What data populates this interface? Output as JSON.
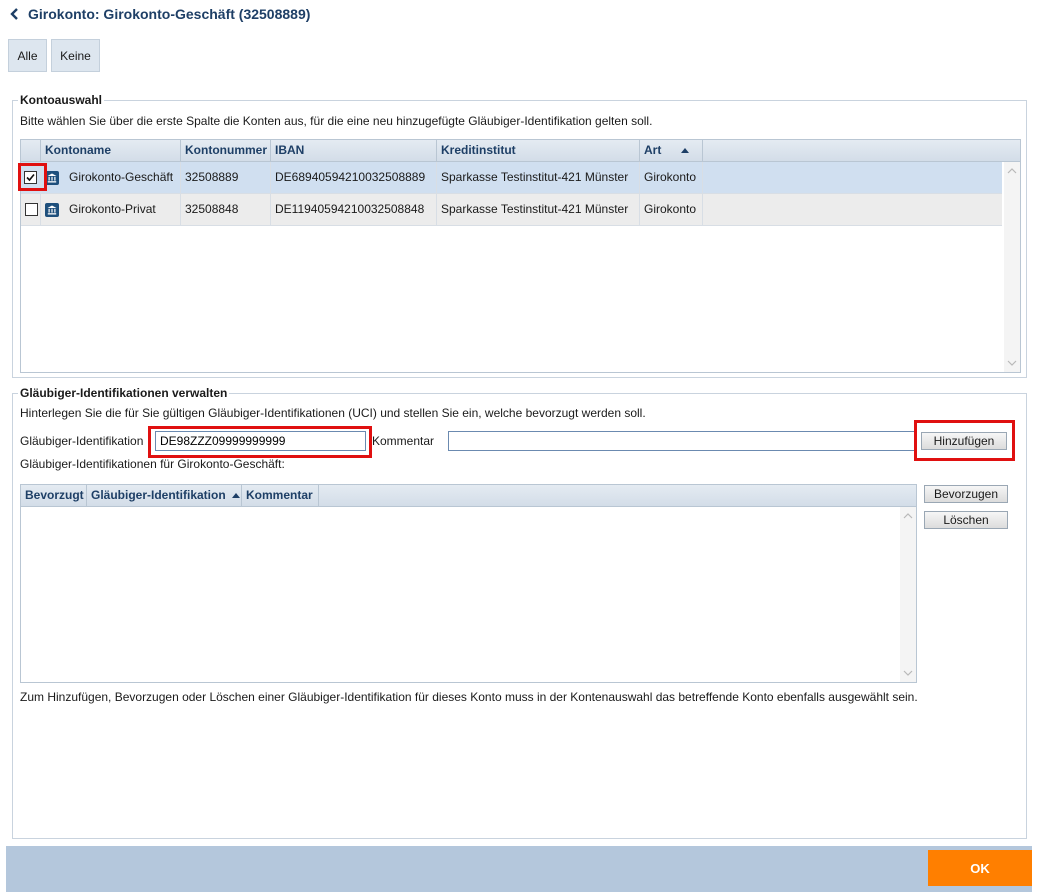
{
  "header": {
    "title": "Girokonto: Girokonto-Geschäft (32508889)"
  },
  "selection": {
    "all_label": "Alle",
    "none_label": "Keine"
  },
  "kontoauswahl": {
    "legend": "Kontoauswahl",
    "description": "Bitte wählen Sie über die erste Spalte die Konten aus, für die eine neu hinzugefügte Gläubiger-Identifikation gelten soll.",
    "columns": [
      "Kontoname",
      "Kontonummer",
      "IBAN",
      "Kreditinstitut",
      "Art"
    ],
    "rows": [
      {
        "checked": true,
        "name": "Girokonto-Geschäft",
        "number": "32508889",
        "iban": "DE68940594210032508889",
        "bank": "Sparkasse Testinstitut-421 Münster",
        "type": "Girokonto"
      },
      {
        "checked": false,
        "name": "Girokonto-Privat",
        "number": "32508848",
        "iban": "DE11940594210032508848",
        "bank": "Sparkasse Testinstitut-421 Münster",
        "type": "Girokonto"
      }
    ]
  },
  "glaeubiger": {
    "legend": "Gläubiger-Identifikationen verwalten",
    "description": "Hinterlegen Sie die für Sie gültigen Gläubiger-Identifikationen (UCI) und stellen Sie ein, welche bevorzugt werden soll.",
    "id_label": "Gläubiger-Identifikation",
    "id_value": "DE98ZZZ09999999999",
    "comment_label": "Kommentar",
    "comment_value": "",
    "add_label": "Hinzufügen",
    "list_title": "Gläubiger-Identifikationen für Girokonto-Geschäft:",
    "columns": [
      "Bevorzugt",
      "Gläubiger-Identifikation",
      "Kommentar"
    ],
    "prefer_label": "Bevorzugen",
    "delete_label": "Löschen",
    "note": "Zum Hinzufügen, Bevorzugen oder Löschen einer Gläubiger-Identifikation für dieses Konto muss in der Kontenauswahl das betreffende Konto ebenfalls ausgewählt sein."
  },
  "footer": {
    "ok_label": "OK"
  },
  "colors": {
    "accent": "#ff7f00",
    "title": "#1e3f66",
    "footer": "#b4c7dc",
    "highlight": "#e01010",
    "selected_row": "#d0dff0"
  }
}
